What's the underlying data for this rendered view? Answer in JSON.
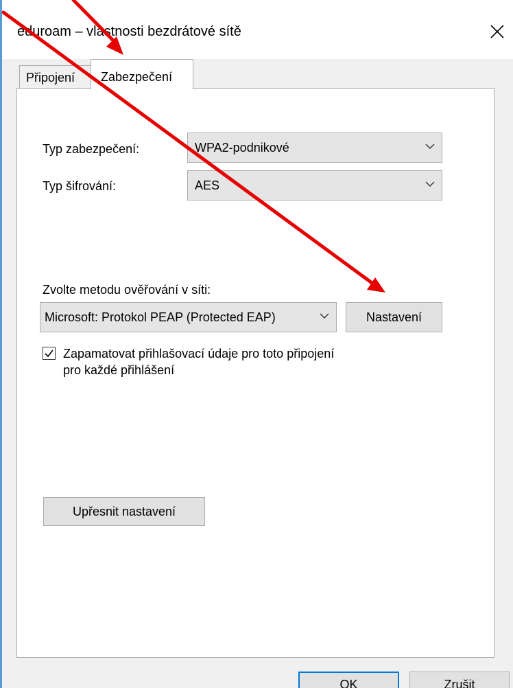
{
  "window": {
    "title": "eduroam – vlastnosti bezdrátové sítě",
    "close_icon": "close-icon"
  },
  "tabs": [
    {
      "label": "Připojení",
      "selected": false
    },
    {
      "label": "Zabezpečení",
      "selected": true
    }
  ],
  "security": {
    "type_label": "Typ zabezpečení:",
    "type_value": "WPA2-podnikové",
    "encryption_label": "Typ šifrování:",
    "encryption_value": "AES",
    "auth_method_label": "Zvolte metodu ověřování v síti:",
    "auth_method_value": "Microsoft: Protokol PEAP (Protected EAP)",
    "settings_button": "Nastavení",
    "remember_checked": true,
    "remember_line1": "Zapamatovat přihlašovací údaje pro toto připojení",
    "remember_line2": "pro každé přihlášení",
    "advanced_button": "Upřesnit nastavení"
  },
  "footer": {
    "ok_button": "OK",
    "cancel_button": "Zrušit"
  },
  "colors": {
    "annotation_arrow": "#e60000",
    "window_border": "#5b9bd5",
    "ok_button_border": "#0078d7"
  }
}
